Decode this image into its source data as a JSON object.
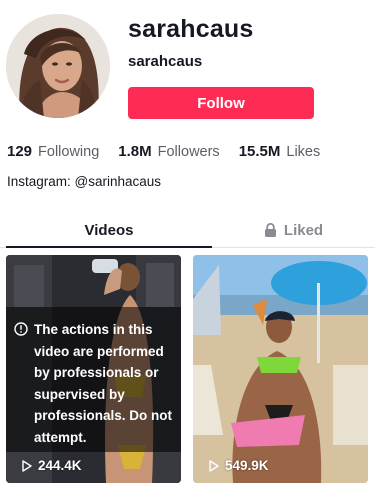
{
  "profile": {
    "username": "sarahcaus",
    "nickname": "sarahcaus",
    "follow_label": "Follow",
    "avatar_icon": "avatar-photo"
  },
  "stats": [
    {
      "value": "129",
      "label": "Following"
    },
    {
      "value": "1.8M",
      "label": "Followers"
    },
    {
      "value": "15.5M",
      "label": "Likes"
    }
  ],
  "bio": "Instagram: @sarinhacaus",
  "tabs": {
    "videos": "Videos",
    "liked": "Liked",
    "liked_icon": "lock-icon"
  },
  "videos": [
    {
      "warning": "The actions in this video are performed by professionals or supervised by professionals. Do not attempt.",
      "warning_icon": "info-icon",
      "views": "244.4K",
      "views_icon": "play-icon"
    },
    {
      "views": "549.9K",
      "views_icon": "play-icon"
    }
  ],
  "colors": {
    "accent": "#fe2c55",
    "text": "#161823",
    "secondary_text": "#5c5d66",
    "inactive_tab": "#8a8b91"
  }
}
